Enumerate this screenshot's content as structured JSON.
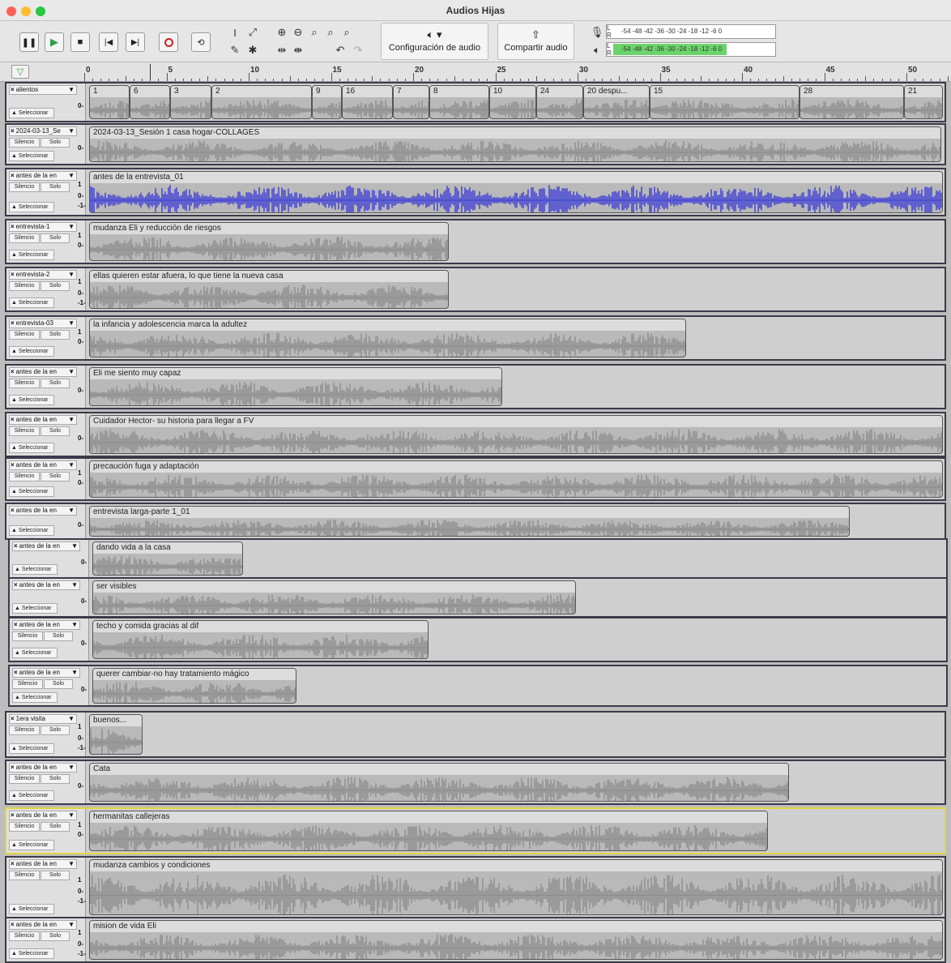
{
  "window": {
    "title": "Audios Hijas"
  },
  "toolbar": {
    "audio_setup_label": "Configuración de audio",
    "share_audio_label": "Compartir audio",
    "meter_ticks": [
      "-54",
      "-48",
      "-42",
      "-36",
      "-30",
      "-24",
      "-18",
      "-12",
      "-6",
      "0"
    ],
    "meter_lr": [
      "L",
      "R"
    ]
  },
  "ruler": {
    "labels": [
      "0",
      "5",
      "10",
      "15",
      "20",
      "25",
      "30",
      "35",
      "40",
      "45",
      "50"
    ]
  },
  "buttons": {
    "mute": "Silencio",
    "solo": "Solo",
    "select": "Seleccionar"
  },
  "scales": {
    "one": "1",
    "zero": "0",
    "minus_one": "-1"
  },
  "tracks": [
    {
      "name": "alientos",
      "clip_labels": [
        "1",
        "6",
        "3",
        "2",
        "9",
        "16",
        "7",
        "8",
        "10",
        "24",
        "20 despu...",
        "15",
        "28",
        "21"
      ],
      "mute_solo": false,
      "scale": "0"
    },
    {
      "name": "2024-03-13_Se",
      "clip_labels": [
        "2024-03-13_Sesión 1 casa hogar-COLLAGES"
      ],
      "mute_solo": true,
      "scale": "0"
    },
    {
      "name": "antes de la en",
      "clip_labels": [
        "antes de la entrevista_01"
      ],
      "mute_solo": true,
      "scale": "1/0/-1"
    },
    {
      "name": "entrevista-1",
      "clip_labels": [
        "mudanza Eli y reducción de riesgos"
      ],
      "mute_solo": true,
      "scale": "1/0"
    },
    {
      "name": "entrevista-2",
      "clip_labels": [
        "ellas quieren estar afuera, lo que tiene la nueva casa"
      ],
      "mute_solo": true,
      "scale": "1/0/-1"
    },
    {
      "name": "entrevista-03",
      "clip_labels": [
        "la infancia y adolescencia marca la adultez"
      ],
      "mute_solo": true,
      "scale": "1/0"
    },
    {
      "name": "antes de la en",
      "clip_labels": [
        "Eli me siento muy capaz"
      ],
      "mute_solo": true,
      "scale": "0"
    },
    {
      "name": "antes de la en",
      "clip_labels": [
        "Cuidador Hector- su historia para llegar a FV"
      ],
      "mute_solo": true,
      "scale": "0"
    },
    {
      "name": "antes de la en",
      "clip_labels": [
        "precaución fuga y adaptación"
      ],
      "mute_solo": true,
      "scale": "1/0"
    },
    {
      "name": "antes de la en",
      "clip_labels": [
        "entrevista larga-parte 1_01"
      ],
      "mute_solo": false,
      "scale": "0"
    },
    {
      "name": "antes de la en",
      "clip_labels": [
        "dando vida a la casa"
      ],
      "mute_solo": false,
      "scale": "0"
    },
    {
      "name": "antes de la en",
      "clip_labels": [
        "ser visibles"
      ],
      "mute_solo": false,
      "scale": "0"
    },
    {
      "name": "antes de la en",
      "clip_labels": [
        "techo y comida gracias al dif"
      ],
      "mute_solo": true,
      "scale": "0"
    },
    {
      "name": "antes de la en",
      "clip_labels": [
        "querer cambiar-no hay tratamiento mágico"
      ],
      "mute_solo": true,
      "scale": "0"
    },
    {
      "name": "1era visita",
      "clip_labels": [
        "buenos..."
      ],
      "mute_solo": true,
      "scale": "1/0/-1"
    },
    {
      "name": "antes de la en",
      "clip_labels": [
        "Cata"
      ],
      "mute_solo": true,
      "scale": "0"
    },
    {
      "name": "antes de la en",
      "clip_labels": [
        "hermanitas callejeras"
      ],
      "mute_solo": true,
      "scale": "1/0"
    },
    {
      "name": "antes de la en",
      "clip_labels": [
        "mudanza cambios y condiciones"
      ],
      "mute_solo": true,
      "scale": "1/0/-1"
    },
    {
      "name": "antes de la en",
      "clip_labels": [
        "mision de vida Eli"
      ],
      "mute_solo": true,
      "scale": "1/0/-1"
    }
  ],
  "colors": {
    "waveform": "#8c8c8c",
    "waveform_selected": "#3b3bd6",
    "selected_track_border": "#e0d640",
    "play_green": "#2e9e4a",
    "record_red": "#cc2222",
    "meter_green": "#6cd36c"
  }
}
